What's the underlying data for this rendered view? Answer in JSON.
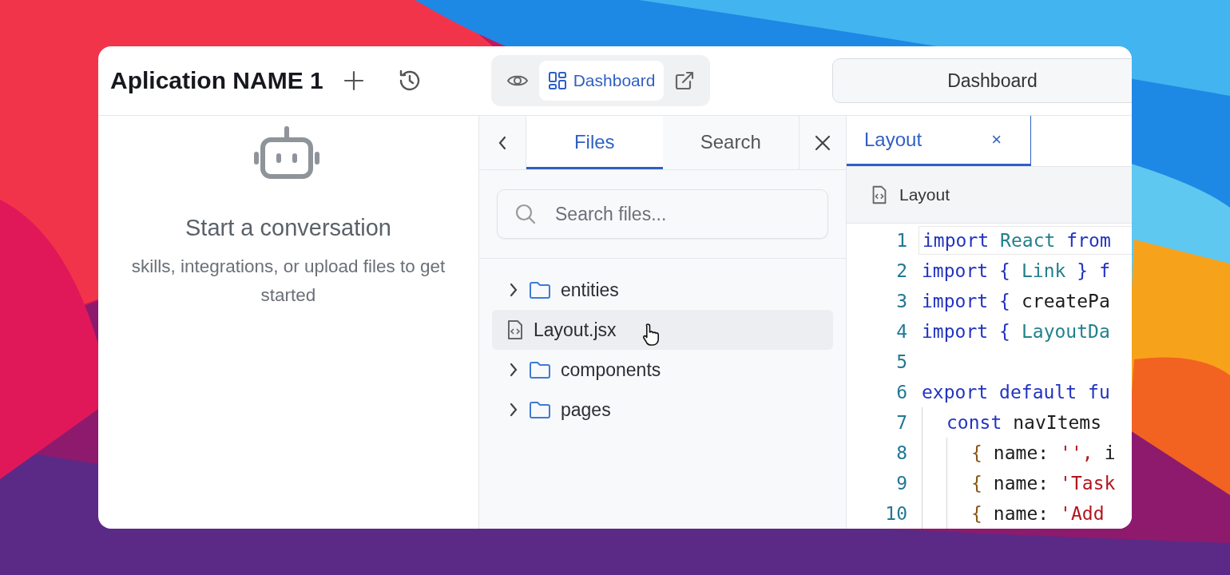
{
  "header": {
    "title": "Aplication NAME 1",
    "view_modes": [
      {
        "kind": "preview",
        "selected": false
      },
      {
        "kind": "dashboard",
        "label": "Dashboard",
        "selected": true
      }
    ],
    "right_button": "Dashboard"
  },
  "chat": {
    "heading": "Start a conversation",
    "subtitle": "skills, integrations, or upload files to get started"
  },
  "files_panel": {
    "tabs": [
      {
        "label": "Files",
        "selected": true
      },
      {
        "label": "Search",
        "selected": false
      }
    ],
    "search": {
      "placeholder": "Search files..."
    },
    "tree": [
      {
        "kind": "folder",
        "name": "entities",
        "expanded": false,
        "selected": false
      },
      {
        "kind": "file",
        "name": "Layout.jsx",
        "selected": true
      },
      {
        "kind": "folder",
        "name": "components",
        "expanded": false,
        "selected": false
      },
      {
        "kind": "folder",
        "name": "pages",
        "expanded": false,
        "selected": false
      }
    ]
  },
  "editor": {
    "tabs": [
      {
        "label": "Layout",
        "selected": true,
        "close": "×"
      }
    ],
    "breadcrumb": "Layout",
    "lines": [
      {
        "number": "1",
        "current": true,
        "tokens": [
          {
            "text": "import",
            "kind": "keyword"
          },
          {
            "text": "React",
            "kind": "type"
          },
          {
            "text": "from",
            "kind": "keyword"
          }
        ]
      },
      {
        "number": "2",
        "current": false,
        "tokens": [
          {
            "text": "import",
            "kind": "keyword"
          },
          {
            "text": "{",
            "kind": "brace"
          },
          {
            "text": "Link",
            "kind": "type"
          },
          {
            "text": "}",
            "kind": "brace"
          },
          {
            "text": "f",
            "kind": "keyword"
          }
        ]
      },
      {
        "number": "3",
        "current": false,
        "tokens": [
          {
            "text": "import",
            "kind": "keyword"
          },
          {
            "text": "{",
            "kind": "brace"
          },
          {
            "text": "createPa",
            "kind": "plain"
          }
        ]
      },
      {
        "number": "4",
        "current": false,
        "tokens": [
          {
            "text": "import",
            "kind": "keyword"
          },
          {
            "text": "{",
            "kind": "brace"
          },
          {
            "text": "LayoutDa",
            "kind": "type"
          }
        ]
      },
      {
        "number": "5",
        "current": false
      },
      {
        "number": "6",
        "current": false,
        "tokens": [
          {
            "text": "export",
            "kind": "keyword"
          },
          {
            "text": "default",
            "kind": "keyword"
          },
          {
            "text": "fu",
            "kind": "keyword"
          }
        ],
        "children": [
          {
            "number": "7",
            "current": false,
            "tokens": [
              {
                "text": "const",
                "kind": "keyword"
              },
              {
                "text": "navItems",
                "kind": "plain"
              }
            ],
            "children": [
              {
                "number": "8",
                "current": false,
                "tokens": [
                  {
                    "text": "{",
                    "kind": "bracket"
                  },
                  {
                    "text": "name:",
                    "kind": "plain"
                  },
                  {
                    "text": "'',",
                    "kind": "string"
                  },
                  {
                    "text": "i",
                    "kind": "plain"
                  }
                ]
              },
              {
                "number": "9",
                "current": false,
                "tokens": [
                  {
                    "text": "{",
                    "kind": "bracket"
                  },
                  {
                    "text": "name:",
                    "kind": "plain"
                  },
                  {
                    "text": "'Task",
                    "kind": "string"
                  }
                ]
              },
              {
                "number": "10",
                "current": false,
                "tokens": [
                  {
                    "text": "{",
                    "kind": "bracket"
                  },
                  {
                    "text": "name:",
                    "kind": "plain"
                  },
                  {
                    "text": "'Add",
                    "kind": "string"
                  }
                ]
              }
            ]
          }
        ]
      }
    ]
  }
}
